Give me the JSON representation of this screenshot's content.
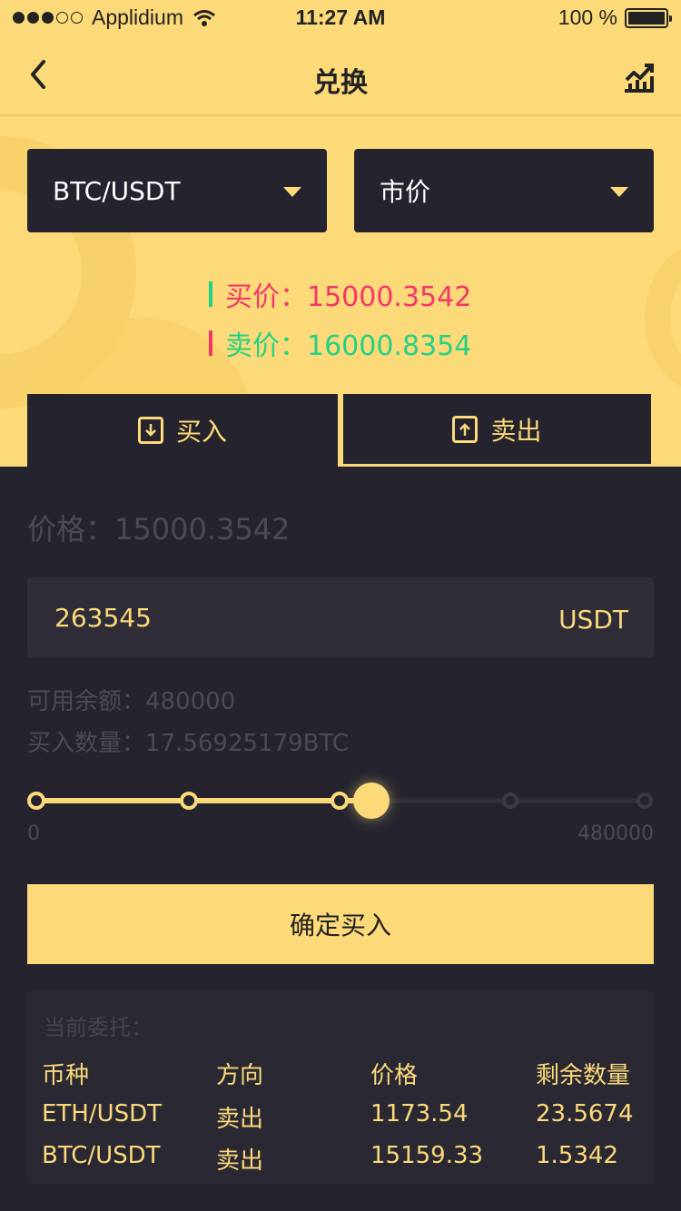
{
  "status_bar": {
    "carrier": "Applidium",
    "time": "11:27 AM",
    "battery": "100 %"
  },
  "nav": {
    "title": "兑换"
  },
  "pair_select": {
    "value": "BTC/USDT"
  },
  "type_select": {
    "value": "市价"
  },
  "quotes": {
    "buy": "买价：15000.3542",
    "sell": "卖价：16000.8354"
  },
  "tabs": [
    {
      "label": "买入"
    },
    {
      "label": "卖出"
    }
  ],
  "form": {
    "price": "价格：15000.3542",
    "amount_value": "263545",
    "amount_unit": "USDT",
    "available": "可用余额：480000",
    "buy_quantity": "买入数量：17.56925179BTC"
  },
  "slider": {
    "min_label": "0",
    "max_label": "480000",
    "fraction": 0.55
  },
  "confirm_label": "确定买入",
  "orders": {
    "title": "当前委托：",
    "headers": [
      "币种",
      "方向",
      "价格",
      "剩余数量"
    ],
    "rows": [
      [
        "ETH/USDT",
        "卖出",
        "1173.54",
        "23.5674"
      ],
      [
        "BTC/USDT",
        "卖出",
        "15159.33",
        "1.5342"
      ]
    ]
  },
  "colors": {
    "accent": "#fcd979",
    "dark": "#25242e",
    "buy": "#f2376a",
    "sell": "#22d284"
  },
  "icons": [
    "back-arrow-icon",
    "chart-icon",
    "caret-down-icon",
    "download-icon",
    "upload-icon"
  ]
}
